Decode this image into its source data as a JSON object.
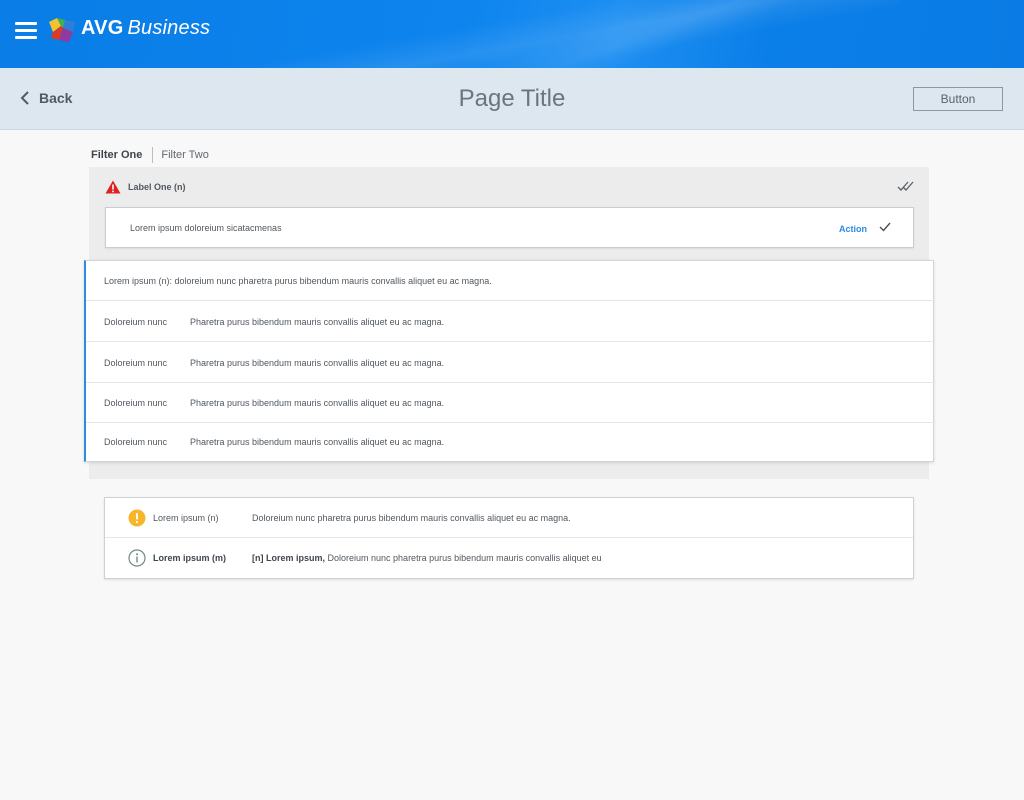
{
  "topbar": {
    "brand_bold": "AVG",
    "brand_italic": "Business",
    "accent": "#0a7de6"
  },
  "header": {
    "back_label": "Back",
    "title": "Page Title",
    "button_label": "Button"
  },
  "filters": {
    "items": [
      {
        "label": "Filter One",
        "active": true
      },
      {
        "label": "Filter Two",
        "active": false
      }
    ]
  },
  "group": {
    "label": "Label One (n)",
    "icon": "warning-icon",
    "warning_color": "#e02020"
  },
  "alert_card": {
    "text": "Lorem ipsum doloreium sicatacmenas",
    "action_label": "Action",
    "action_color": "#2d8ce0"
  },
  "detail_card": {
    "summary": "Lorem ipsum (n): doloreium nunc pharetra purus bibendum mauris convallis aliquet eu ac magna.",
    "rows": [
      {
        "key": "Doloreium nunc",
        "value": "Pharetra purus bibendum mauris convallis aliquet eu ac magna."
      },
      {
        "key": "Doloreium nunc",
        "value": "Pharetra purus bibendum mauris convallis aliquet eu ac magna."
      },
      {
        "key": "Doloreium nunc",
        "value": "Pharetra purus bibendum mauris convallis aliquet eu ac magna."
      },
      {
        "key": "Doloreium nunc",
        "value": "Pharetra purus bibendum mauris convallis aliquet eu ac magna."
      }
    ]
  },
  "notice_card": {
    "rows": [
      {
        "icon": "exclamation-circle-icon",
        "label": "Lorem ipsum (n)",
        "desc": "Doloreium nunc pharetra purus bibendum mauris convallis aliquet eu ac magna.",
        "icon_color": "#f6b52a"
      },
      {
        "icon": "info-circle-icon",
        "label": "Lorem ipsum (m)",
        "desc_bold": "[n] Lorem ipsum,",
        "desc": " Doloreium nunc pharetra purus bibendum mauris convallis aliquet eu",
        "icon_color": "#6f8a7e"
      }
    ]
  }
}
